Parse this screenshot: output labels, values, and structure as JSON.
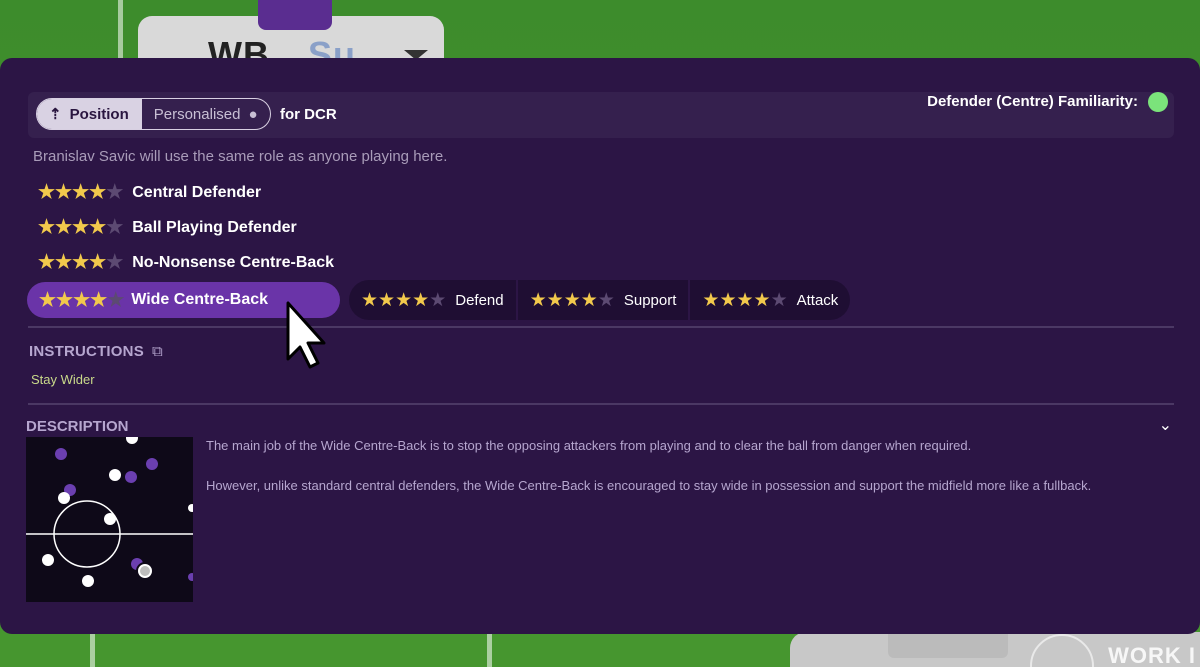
{
  "background": {
    "card_title_left": "WB",
    "card_title_right": "Su",
    "watermark": "WORK I"
  },
  "header": {
    "toggle": {
      "position_label": "Position",
      "personalised_label": "Personalised"
    },
    "for_label": "for DCR",
    "familiarity_label": "Defender (Centre) Familiarity:",
    "familiarity_color": "#7be37b"
  },
  "info_text": "Branislav Savic will use the same role as anyone playing here.",
  "roles": [
    {
      "label": "Central Defender",
      "rating": 3.5
    },
    {
      "label": "Ball Playing Defender",
      "rating": 3.5
    },
    {
      "label": "No-Nonsense Centre-Back",
      "rating": 3.5
    }
  ],
  "selected_role": {
    "label": "Wide Centre-Back",
    "rating": 4
  },
  "duties": [
    {
      "label": "Defend",
      "rating": 4
    },
    {
      "label": "Support",
      "rating": 4
    },
    {
      "label": "Attack",
      "rating": 4
    }
  ],
  "instructions": {
    "title": "INSTRUCTIONS",
    "items": [
      "Stay Wider"
    ]
  },
  "description": {
    "title": "DESCRIPTION",
    "paragraphs": [
      "The main job of the Wide Centre-Back is to stop the opposing attackers from playing and to clear the ball from danger when required.",
      "However, unlike standard central defenders, the Wide Centre-Back is encouraged to stay wide in possession and support the midfield more like a fullback."
    ]
  },
  "colors": {
    "panel": "#2c1545",
    "accent": "#6a34a8",
    "star": "#f2c94c",
    "star_empty": "#5c4a72"
  }
}
